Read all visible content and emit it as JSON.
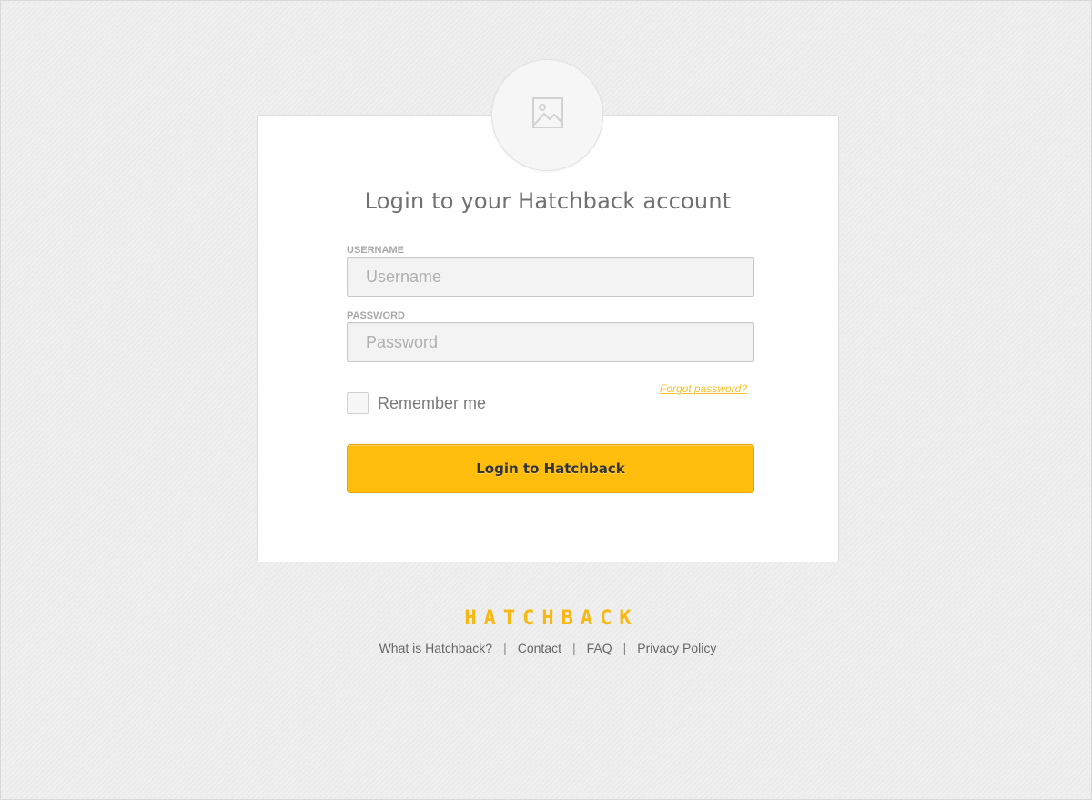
{
  "login": {
    "title": "Login to your Hatchback account",
    "username_label": "USERNAME",
    "username_placeholder": "Username",
    "password_label": "PASSWORD",
    "password_placeholder": "Password",
    "remember_label": "Remember me",
    "forgot_label": "Forgot password?",
    "submit_label": "Login to Hatchback",
    "avatar_icon": "image-placeholder-icon"
  },
  "brand": {
    "logo_text": "HATCHBACK",
    "accent_color": "#ffbe0e"
  },
  "footer": {
    "links": [
      "What is Hatchback?",
      "Contact",
      "FAQ",
      "Privacy Policy"
    ],
    "separator": "|"
  }
}
